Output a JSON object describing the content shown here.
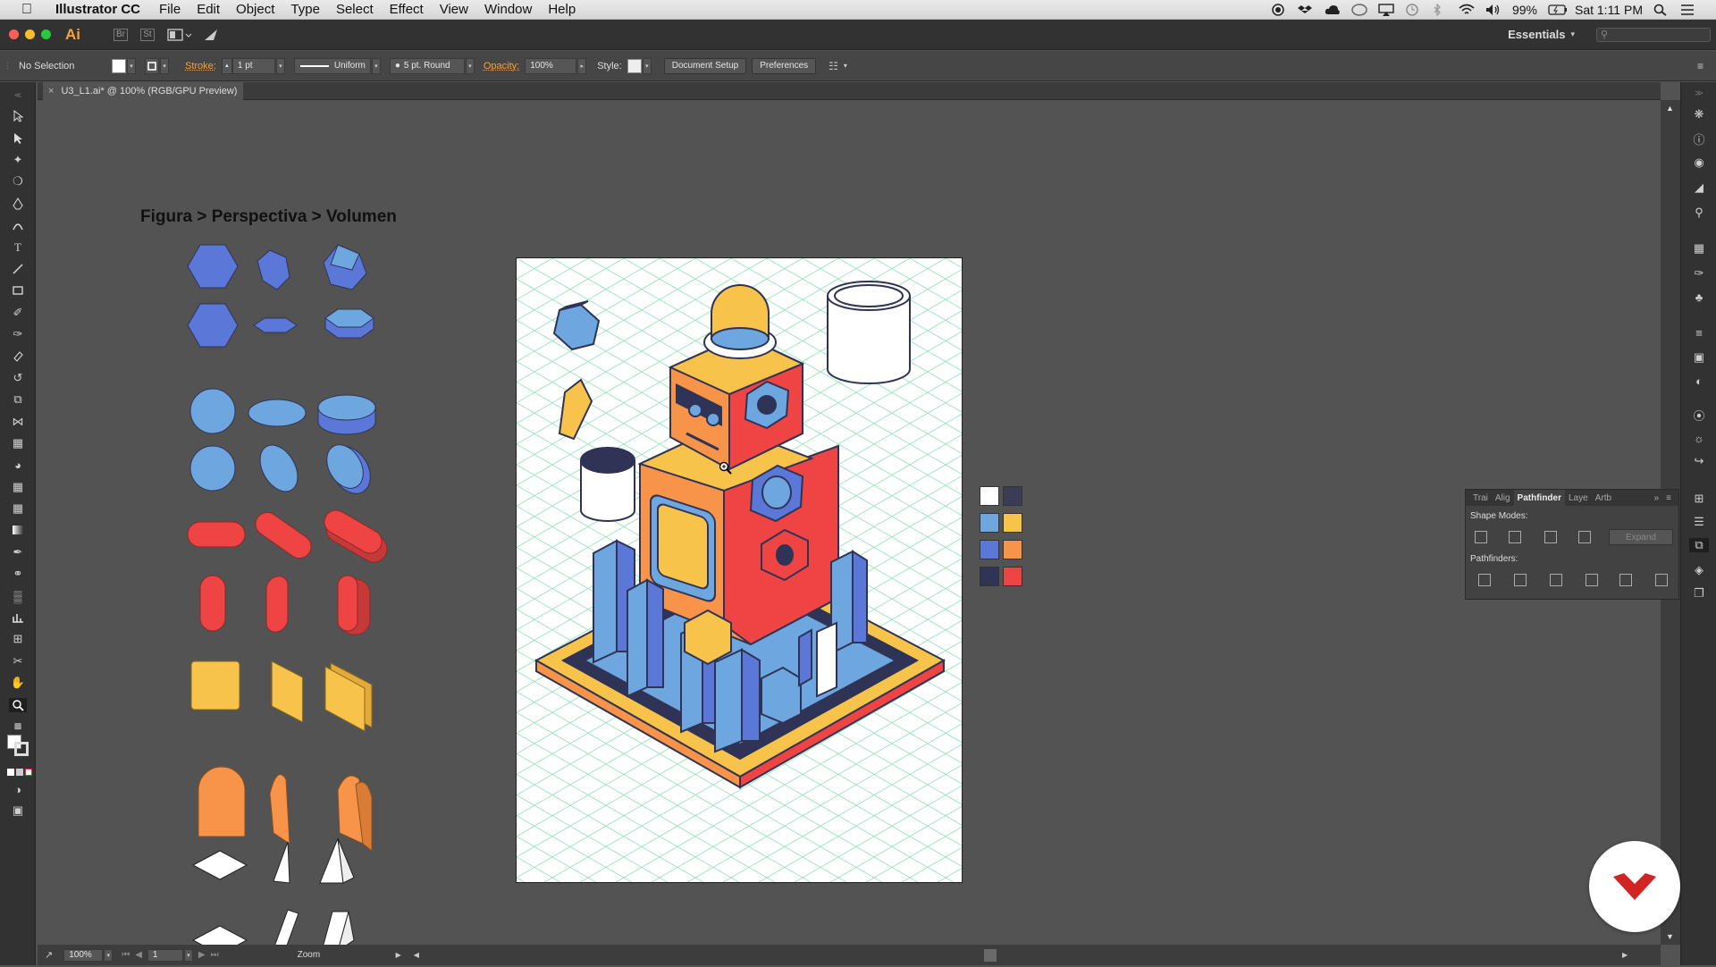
{
  "menubar": {
    "app_name": "Illustrator CC",
    "menus": [
      "File",
      "Edit",
      "Object",
      "Type",
      "Select",
      "Effect",
      "View",
      "Window",
      "Help"
    ],
    "battery": "99%",
    "clock": "Sat 1:11 PM"
  },
  "approw": {
    "logo": "Ai",
    "workspace": "Essentials",
    "bridge_label": "Br",
    "stock_label": "St"
  },
  "control": {
    "selection": "No Selection",
    "stroke_label": "Stroke:",
    "stroke_value": "1 pt",
    "profile": "Uniform",
    "brush": "5 pt. Round",
    "opacity_label": "Opacity:",
    "opacity_value": "100%",
    "style_label": "Style:",
    "doc_setup": "Document Setup",
    "preferences": "Preferences"
  },
  "document": {
    "tab_title": "U3_L1.ai* @ 100% (RGB/GPU Preview)",
    "heading": "Figura > Perspectiva > Volumen"
  },
  "statusbar": {
    "zoom": "100%",
    "artboard": "1",
    "tool": "Zoom"
  },
  "pathfinder": {
    "tabs": [
      "Trai",
      "Alig",
      "Pathfinder",
      "Laye",
      "Artb"
    ],
    "shape_modes": "Shape Modes:",
    "expand": "Expand",
    "pathfinders": "Pathfinders:"
  },
  "colors": {
    "blue": "#5b78d8",
    "light_blue": "#6ea6e0",
    "red": "#ee4444",
    "yellow": "#f7c34a",
    "orange": "#f7944a",
    "navy": "#2f3355",
    "grid": "#8ee0b8"
  },
  "swatches": [
    "#ffffff",
    "#3a3d55",
    "#6ea6e0",
    "#f7c34a",
    "#5b78d8",
    "#f7944a",
    "#2f3355",
    "#ee4444"
  ]
}
